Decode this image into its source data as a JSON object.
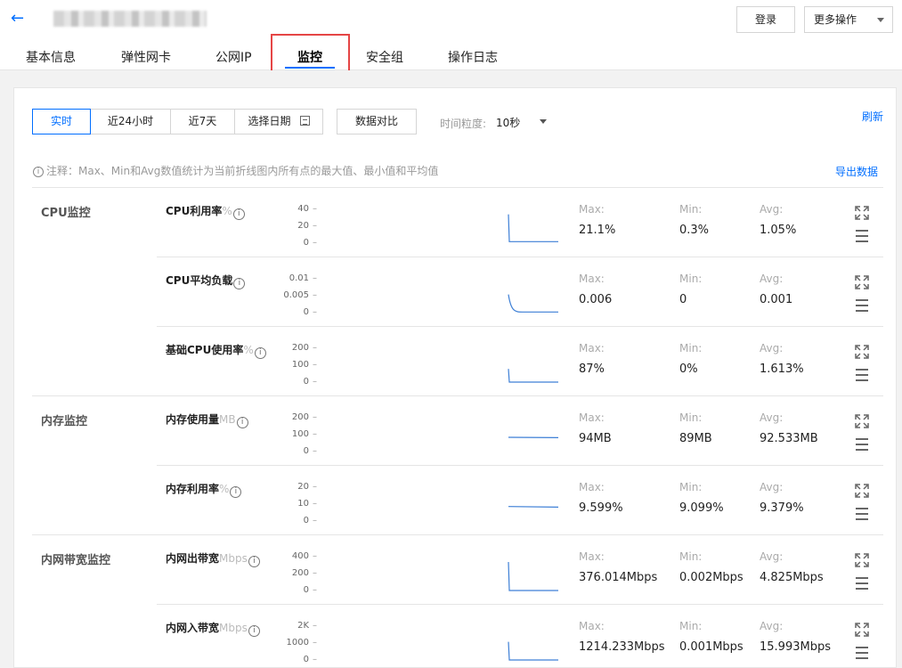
{
  "header": {
    "back_glyph": "←",
    "login_label": "登录",
    "more_label": "更多操作"
  },
  "tabs": [
    "基本信息",
    "弹性网卡",
    "公网IP",
    "监控",
    "安全组",
    "操作日志"
  ],
  "active_tab": "监控",
  "toolbar": {
    "ranges": [
      "实时",
      "近24小时",
      "近7天",
      "选择日期"
    ],
    "active_range": "实时",
    "compare_label": "数据对比",
    "granularity_label": "时间粒度:",
    "granularity_value": "10秒",
    "refresh_label": "刷新"
  },
  "note": {
    "icon": "i",
    "text": "注释：Max、Min和Avg数值统计为当前折线图内所有点的最大值、最小值和平均值",
    "export_label": "导出数据"
  },
  "stat_labels": {
    "max": "Max:",
    "min": "Min:",
    "avg": "Avg:"
  },
  "groups": [
    {
      "label": "CPU监控"
    },
    {
      "label": "内存监控"
    },
    {
      "label": "内网带宽监控"
    }
  ],
  "metrics": [
    {
      "name": "CPU利用率",
      "unit": "%",
      "ticks": [
        "40",
        "20",
        "0"
      ],
      "max": "21.1%",
      "min": "0.3%",
      "avg": "1.05%",
      "spark_level": [
        0.95,
        0.05
      ]
    },
    {
      "name": "CPU平均负载",
      "unit": "",
      "ticks": [
        "0.01",
        "0.005",
        "0"
      ],
      "max": "0.006",
      "min": "0",
      "avg": "0.001",
      "spark_level": [
        0.6,
        0.02
      ]
    },
    {
      "name": "基础CPU使用率",
      "unit": "%",
      "ticks": [
        "200",
        "100",
        "0"
      ],
      "max": "87%",
      "min": "0%",
      "avg": "1.613%",
      "spark_level": [
        0.435,
        0.0
      ]
    },
    {
      "name": "内存使用量",
      "unit": "MB",
      "ticks": [
        "200",
        "100",
        "0"
      ],
      "max": "94MB",
      "min": "89MB",
      "avg": "92.533MB",
      "spark_level": [
        0.47,
        0.46
      ]
    },
    {
      "name": "内存利用率",
      "unit": "%",
      "ticks": [
        "20",
        "10",
        "0"
      ],
      "max": "9.599%",
      "min": "9.099%",
      "avg": "9.379%",
      "spark_level": [
        0.48,
        0.46
      ]
    },
    {
      "name": "内网出带宽",
      "unit": "Mbps",
      "ticks": [
        "400",
        "200",
        "0"
      ],
      "max": "376.014Mbps",
      "min": "0.002Mbps",
      "avg": "4.825Mbps",
      "spark_level": [
        0.94,
        0.0
      ]
    },
    {
      "name": "内网入带宽",
      "unit": "Mbps",
      "ticks": [
        "2K",
        "1000",
        "0"
      ],
      "max": "1214.233Mbps",
      "min": "0.001Mbps",
      "avg": "15.993Mbps",
      "spark_level": [
        0.6,
        0.0
      ]
    }
  ],
  "colors": {
    "accent": "#006eff",
    "annotation_box": "#e54545",
    "line": "#3d7fd6"
  }
}
